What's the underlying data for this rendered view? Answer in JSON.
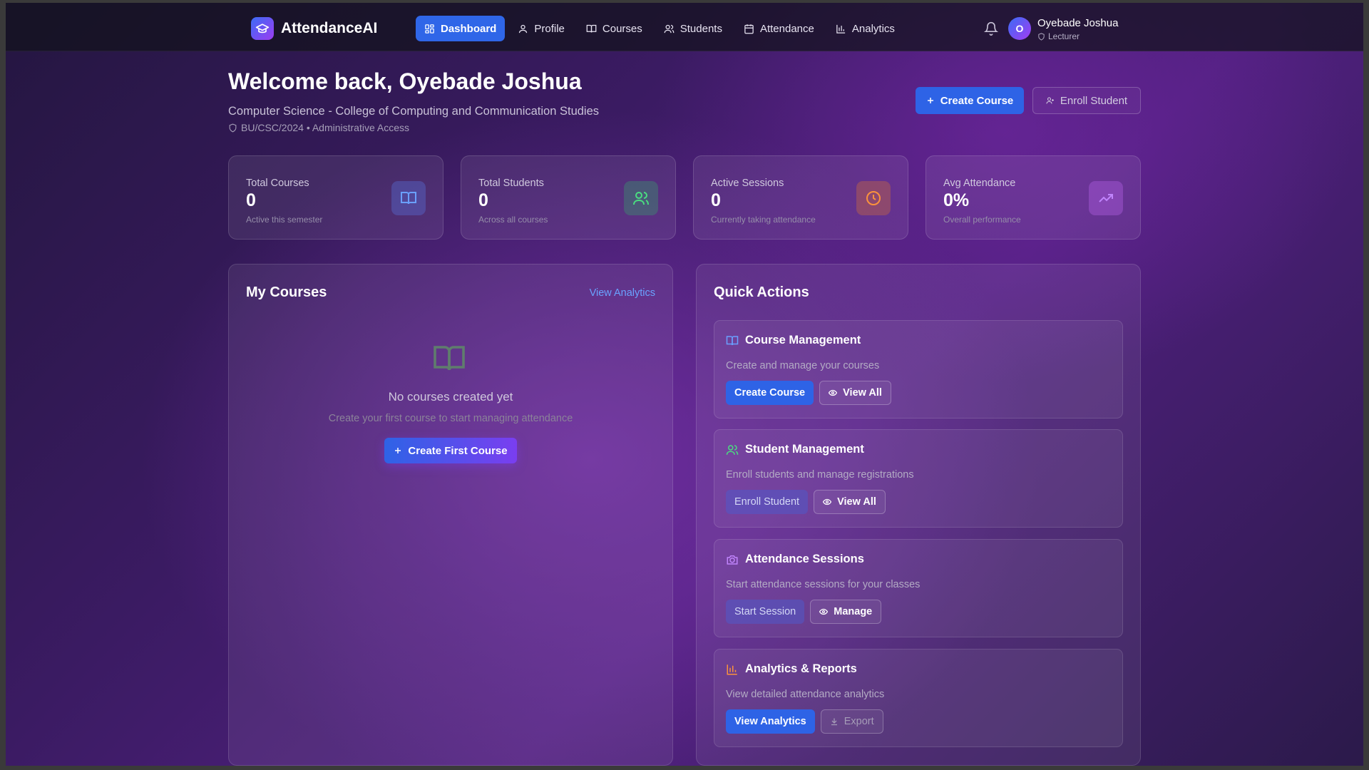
{
  "app": {
    "name": "AttendanceAI"
  },
  "nav": {
    "items": [
      {
        "label": "Dashboard",
        "icon": "dashboard-icon",
        "active": true
      },
      {
        "label": "Profile",
        "icon": "user-icon",
        "active": false
      },
      {
        "label": "Courses",
        "icon": "book-icon",
        "active": false
      },
      {
        "label": "Students",
        "icon": "users-icon",
        "active": false
      },
      {
        "label": "Attendance",
        "icon": "calendar-icon",
        "active": false
      },
      {
        "label": "Analytics",
        "icon": "bar-chart-icon",
        "active": false
      }
    ],
    "user": {
      "initial": "O",
      "name": "Oyebade Joshua",
      "role": "Lecturer"
    }
  },
  "header": {
    "welcome": "Welcome back, Oyebade Joshua",
    "department": "Computer Science - College of Computing and Communication Studies",
    "meta": "BU/CSC/2024 • Administrative Access",
    "create_course_label": "Create Course",
    "enroll_student_label": "Enroll Student"
  },
  "stats": [
    {
      "label": "Total Courses",
      "value": "0",
      "sub": "Active this semester",
      "icon": "book-icon",
      "color": "#6aa0ff"
    },
    {
      "label": "Total Students",
      "value": "0",
      "sub": "Across all courses",
      "icon": "users-icon",
      "color": "#4ade80"
    },
    {
      "label": "Active Sessions",
      "value": "0",
      "sub": "Currently taking attendance",
      "icon": "clock-icon",
      "color": "#fb923c"
    },
    {
      "label": "Avg Attendance",
      "value": "0%",
      "sub": "Overall performance",
      "icon": "trending-up-icon",
      "color": "#c084fc"
    }
  ],
  "my_courses": {
    "title": "My Courses",
    "link": "View Analytics",
    "empty_title": "No courses created yet",
    "empty_sub": "Create your first course to start managing attendance",
    "button": "Create First Course"
  },
  "quick_actions": {
    "title": "Quick Actions",
    "cards": [
      {
        "title": "Course Management",
        "desc": "Create and manage your courses",
        "primary": "Create Course",
        "secondary": "View All",
        "icon": "book-icon",
        "color": "#6aa0ff"
      },
      {
        "title": "Student Management",
        "desc": "Enroll students and manage registrations",
        "primary": "Enroll Student",
        "secondary": "View All",
        "icon": "users-icon",
        "color": "#4ade80"
      },
      {
        "title": "Attendance Sessions",
        "desc": "Start attendance sessions for your classes",
        "primary": "Start Session",
        "secondary": "Manage",
        "icon": "camera-icon",
        "color": "#c084fc"
      },
      {
        "title": "Analytics & Reports",
        "desc": "View detailed attendance analytics",
        "primary": "View Analytics",
        "secondary": "Export",
        "icon": "bar-chart-icon",
        "color": "#fb923c"
      }
    ]
  }
}
